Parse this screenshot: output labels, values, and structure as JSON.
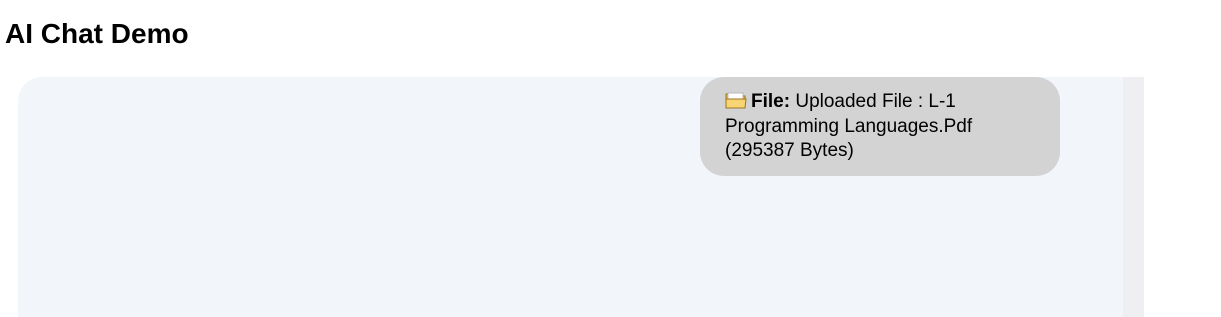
{
  "header": {
    "title": "AI Chat Demo"
  },
  "chat": {
    "messages": [
      {
        "icon": "open-folder-icon",
        "label": "File:",
        "text": "Uploaded File : L-1 Programming Languages.Pdf (295387 Bytes)"
      }
    ]
  },
  "colors": {
    "chat_background": "#f2f5fa",
    "bubble_background": "#d3d3d3",
    "scrollbar_track": "#efeff1",
    "folder_yellow": "#f8d472"
  }
}
